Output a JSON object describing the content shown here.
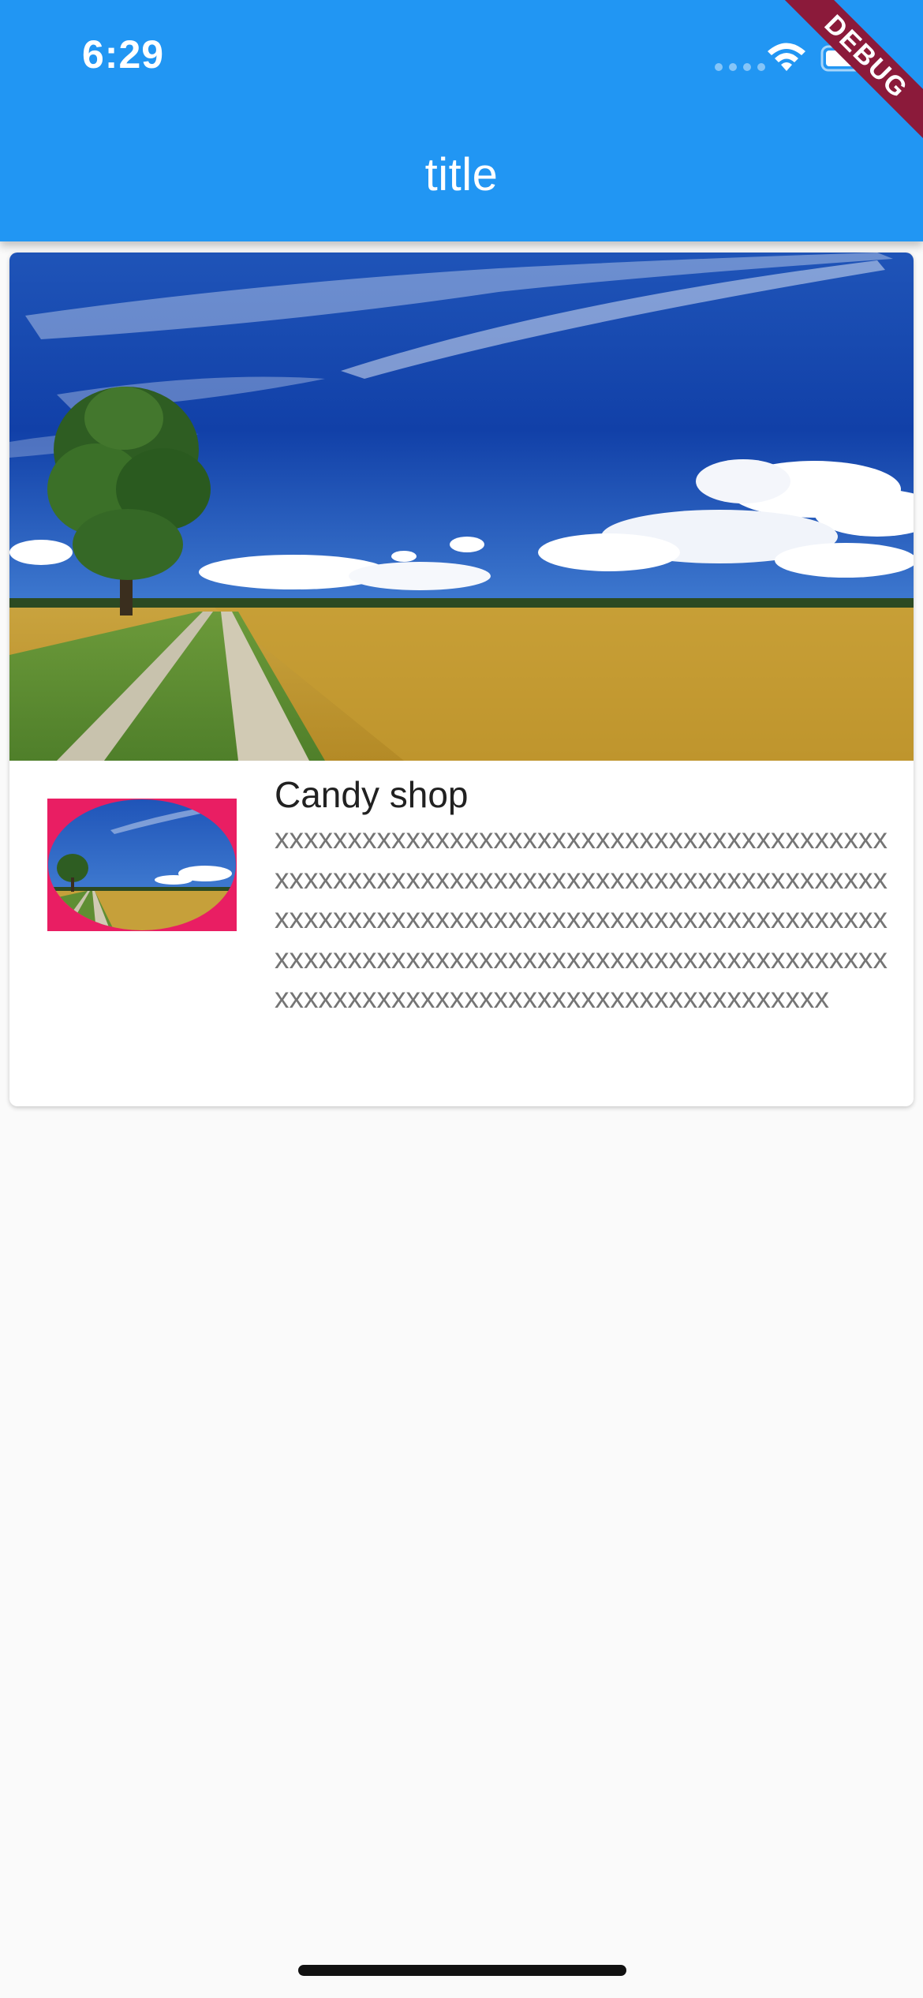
{
  "status_bar": {
    "time": "6:29"
  },
  "app_bar": {
    "title": "title"
  },
  "debug_banner": {
    "label": "DEBUG"
  },
  "card": {
    "title": "Candy shop",
    "body": "xxxxxxxxxxxxxxxxxxxxxxxxxxxxxxxxxxxxxxxxxxxxxxxxxxxxxxxxxxxxxxxxxxxxxxxxxxxxxxxxxxxxxxxxxxxxxxxxxxxxxxxxxxxxxxxxxxxxxxxxxxxxxxxxxxxxxxxxxxxxxxxxxxxxxxxxxxxxxxxxxxxxxxxxxxxxxxxxxxxxxxxxxxxxxxxxxxxxxxxxxxxxxx",
    "hero_image": "landscape-field-photo",
    "thumbnail_image": "landscape-field-oval-thumbnail"
  },
  "colors": {
    "primary": "#2196f3",
    "thumbnail_background": "#e91e63",
    "background": "#fafafa"
  },
  "icons": [
    "wifi-icon",
    "battery-icon",
    "cellular-signal-icon"
  ]
}
